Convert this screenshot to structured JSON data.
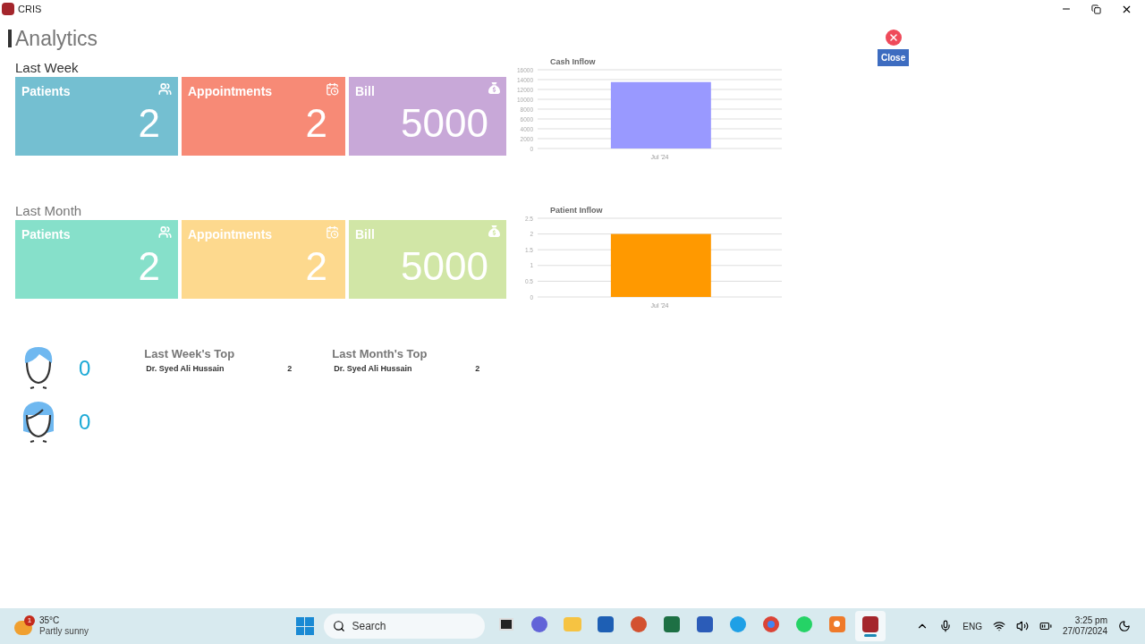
{
  "window": {
    "title": "CRIS"
  },
  "page": {
    "title": "Analytics"
  },
  "close_button": {
    "label": "Close"
  },
  "sections": [
    {
      "title": "Last Week",
      "cards": [
        {
          "kind": "patients",
          "label": "Patients",
          "value": "2",
          "color": "#74bfd1"
        },
        {
          "kind": "appointments",
          "label": "Appointments",
          "value": "2",
          "color": "#f78a76"
        },
        {
          "kind": "bill",
          "label": "Bill",
          "value": "5000",
          "color": "#c8a8d8"
        }
      ]
    },
    {
      "title": "Last Month",
      "cards": [
        {
          "kind": "patients",
          "label": "Patients",
          "value": "2",
          "color": "#86e0ca"
        },
        {
          "kind": "appointments",
          "label": "Appointments",
          "value": "2",
          "color": "#fdd98e"
        },
        {
          "kind": "bill",
          "label": "Bill",
          "value": "5000",
          "color": "#d1e6a6"
        }
      ]
    }
  ],
  "charts": [
    {
      "chart_data": {
        "type": "bar",
        "title": "Cash Inflow",
        "categories": [
          "Jul '24"
        ],
        "series": [
          {
            "color": "#9999ff",
            "values": [
              13500
            ]
          }
        ],
        "grid": true,
        "ylim": [
          0,
          16000
        ],
        "yticks": [
          0,
          2000,
          4000,
          6000,
          8000,
          10000,
          12000,
          14000,
          16000
        ]
      }
    },
    {
      "chart_data": {
        "type": "bar",
        "title": "Patient Inflow",
        "categories": [
          "Jul '24"
        ],
        "series": [
          {
            "color": "#ff9900",
            "values": [
              2
            ]
          }
        ],
        "grid": true,
        "ylim": [
          0,
          2.5
        ],
        "yticks": [
          0,
          0.5,
          1,
          1.5,
          2,
          2.5
        ]
      }
    }
  ],
  "gender_counts": [
    {
      "kind": "male",
      "count": "0"
    },
    {
      "kind": "female",
      "count": "0"
    }
  ],
  "top_lists": [
    {
      "title": "Last Week's Top",
      "rows": [
        {
          "name": "Dr. Syed Ali Hussain",
          "count": "2"
        }
      ]
    },
    {
      "title": "Last Month's Top",
      "rows": [
        {
          "name": "Dr. Syed Ali Hussain",
          "count": "2"
        }
      ]
    }
  ],
  "taskbar": {
    "weather": {
      "temperature": "35°C",
      "condition": "Partly sunny",
      "badge": "1"
    },
    "search": {
      "placeholder": "Search"
    },
    "apps": [
      {
        "kind": "taskview",
        "selected": false
      },
      {
        "kind": "teams",
        "selected": false
      },
      {
        "kind": "explorer",
        "selected": false
      },
      {
        "kind": "store",
        "selected": false
      },
      {
        "kind": "powerpoint",
        "selected": false
      },
      {
        "kind": "excel",
        "selected": false
      },
      {
        "kind": "word",
        "selected": false
      },
      {
        "kind": "skype",
        "selected": false
      },
      {
        "kind": "chrome",
        "selected": false
      },
      {
        "kind": "whatsapp",
        "selected": false
      },
      {
        "kind": "recorder",
        "selected": false
      },
      {
        "kind": "access",
        "selected": true
      }
    ],
    "language": "ENG",
    "time": "3:25 pm",
    "date": "27/07/2024"
  }
}
